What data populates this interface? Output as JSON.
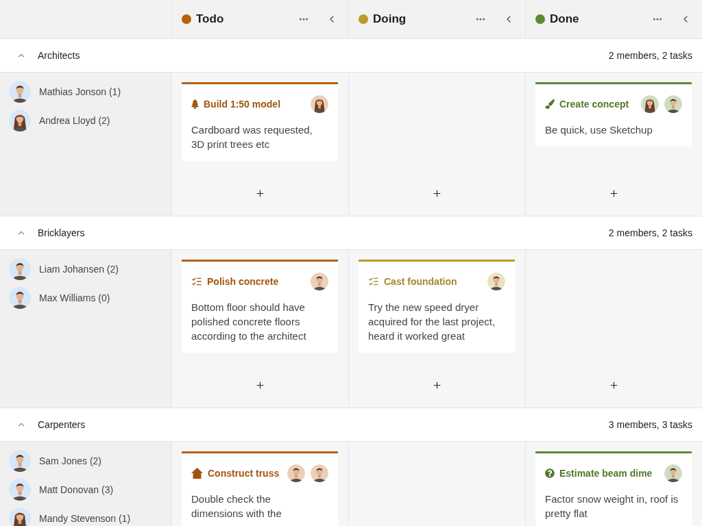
{
  "columns": [
    {
      "kind": "todo",
      "title": "Todo",
      "color": "#b5620e"
    },
    {
      "kind": "doing",
      "title": "Doing",
      "color": "#bb9a2c"
    },
    {
      "kind": "done",
      "title": "Done",
      "color": "#5b8a31"
    }
  ],
  "groups": [
    {
      "name": "Architects",
      "expanded": true,
      "summary": "2 members, 2 tasks",
      "members": [
        {
          "name": "Mathias Jonson (1)",
          "kind": "short-hair"
        },
        {
          "name": "Andrea Lloyd (2)",
          "kind": "long-hair"
        }
      ],
      "cards": [
        {
          "kind": "todo",
          "icon": {
            "kind": "tree"
          },
          "title": "Build 1:50 model",
          "description": "Cardboard was requested, 3D print trees etc",
          "assignees": [
            {
              "kind": "long-hair"
            }
          ]
        },
        {
          "kind": "done",
          "icon": {
            "kind": "brush"
          },
          "title": "Create concept",
          "description": "Be quick, use Sketchup",
          "assignees": [
            {
              "kind": "long-hair"
            },
            {
              "kind": "short-hair"
            }
          ]
        }
      ]
    },
    {
      "name": "Bricklayers",
      "expanded": true,
      "summary": "2 members, 2 tasks",
      "members": [
        {
          "name": "Liam Johansen (2)",
          "kind": "short-hair"
        },
        {
          "name": "Max Williams (0)",
          "kind": "short-hair"
        }
      ],
      "cards": [
        {
          "kind": "todo",
          "icon": {
            "kind": "checklist"
          },
          "title": "Polish concrete",
          "description": "Bottom floor should have polished concrete floors according to the architect",
          "assignees": [
            {
              "kind": "short-hair"
            }
          ]
        },
        {
          "kind": "doing",
          "icon": {
            "kind": "checklist"
          },
          "title": "Cast foundation",
          "description": "Try the new speed dryer acquired for the last project, heard it worked great",
          "assignees": [
            {
              "kind": "short-hair"
            }
          ]
        }
      ]
    },
    {
      "name": "Carpenters",
      "expanded": true,
      "summary": "3 members, 3 tasks",
      "members": [
        {
          "name": "Sam Jones (2)",
          "kind": "short-hair"
        },
        {
          "name": "Matt Donovan (3)",
          "kind": "short-hair"
        },
        {
          "name": "Mandy Stevenson (1)",
          "kind": "long-hair"
        }
      ],
      "cards": [
        {
          "kind": "todo",
          "icon": {
            "kind": "home"
          },
          "title": "Construct truss",
          "description": "Double check the dimensions with the",
          "assignees": [
            {
              "kind": "short-hair"
            },
            {
              "kind": "short-hair"
            }
          ]
        },
        {
          "kind": "done",
          "icon": {
            "kind": "question"
          },
          "title": "Estimate beam dime",
          "description": "Factor snow weight in, roof is pretty flat",
          "assignees": [
            {
              "kind": "short-hair"
            }
          ]
        }
      ]
    }
  ]
}
